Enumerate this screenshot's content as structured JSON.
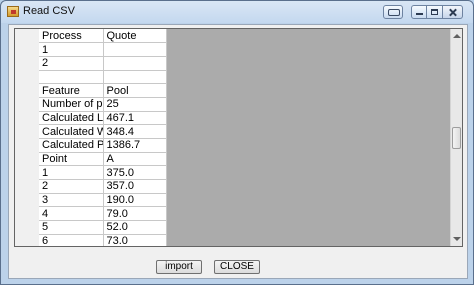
{
  "window": {
    "title": "Read CSV"
  },
  "grid": {
    "columns": [
      "Process",
      "Quote"
    ],
    "rows": [
      [
        "1",
        ""
      ],
      [
        "2",
        ""
      ],
      [
        "",
        ""
      ],
      [
        "Feature",
        "Pool"
      ],
      [
        "Number of points",
        "25"
      ],
      [
        "Calculated Length",
        "467.1"
      ],
      [
        "Calculated Width",
        "348.4"
      ],
      [
        "Calculated Perim...",
        "1386.7"
      ],
      [
        "Point",
        "A"
      ],
      [
        "1",
        "375.0"
      ],
      [
        "2",
        "357.0"
      ],
      [
        "3",
        "190.0"
      ],
      [
        "4",
        "79.0"
      ],
      [
        "5",
        "52.0"
      ],
      [
        "6",
        "73.0"
      ]
    ]
  },
  "buttons": {
    "import_label": "import",
    "close_label": "CLOSE"
  }
}
